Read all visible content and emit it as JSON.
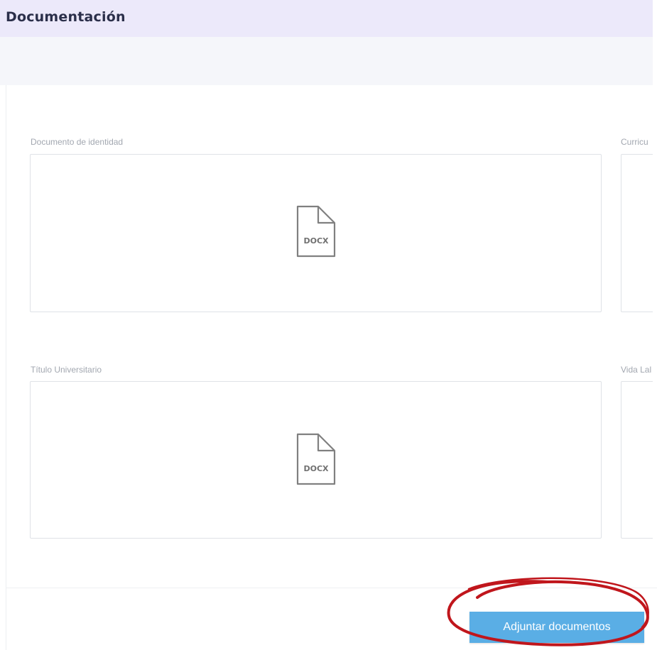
{
  "header": {
    "title": "Documentación"
  },
  "documents": [
    {
      "label": "Documento de identidad",
      "file_type": "DOCX",
      "icon": "docx-file-icon"
    },
    {
      "label": "Curricu",
      "file_type": ""
    },
    {
      "label": "Título Universitario",
      "file_type": "DOCX",
      "icon": "docx-file-icon"
    },
    {
      "label": "Vida Lal",
      "file_type": ""
    }
  ],
  "actions": {
    "attach_label": "Adjuntar documentos"
  },
  "annotation": {
    "color": "#c0161c",
    "shape": "hand-drawn-circle"
  },
  "colors": {
    "header_bg": "#ece9fa",
    "button_bg": "#5aaee5",
    "title_text": "#2b2f4a"
  }
}
